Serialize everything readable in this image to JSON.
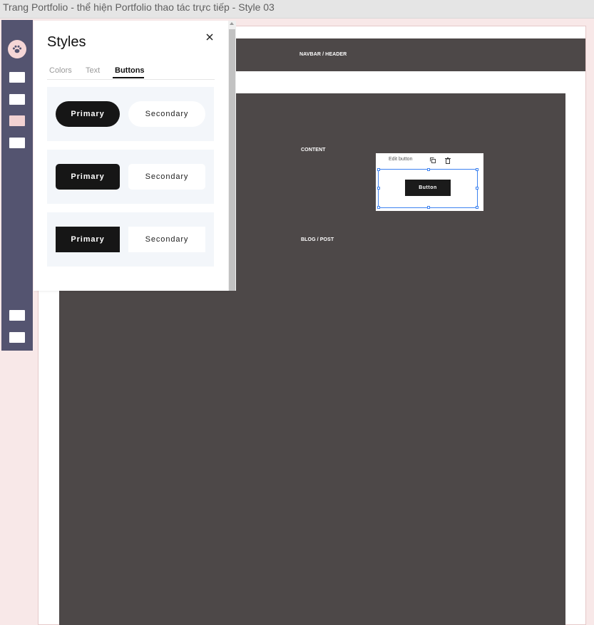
{
  "window": {
    "title": "Trang Portfolio - thể hiện Portfolio thao tác trực tiếp - Style 03"
  },
  "rail": {
    "logo_icon": "paw-icon",
    "items": [
      {
        "name": "rail-item-1",
        "active": false
      },
      {
        "name": "rail-item-2",
        "active": false
      },
      {
        "name": "rail-item-3",
        "active": true
      },
      {
        "name": "rail-item-4",
        "active": false
      },
      {
        "name": "rail-item-5",
        "active": false
      },
      {
        "name": "rail-item-6",
        "active": false
      }
    ]
  },
  "canvas": {
    "navbar_label": "NAVBAR / HEADER",
    "content_label": "CONTENT",
    "blog_label": "BLOG / POST",
    "widget": {
      "toolbar_label": "Edit button",
      "duplicate_icon": "duplicate-icon",
      "delete_icon": "trash-icon",
      "button_label": "Button"
    }
  },
  "panel": {
    "title": "Styles",
    "close_icon": "close-icon",
    "tabs": [
      {
        "label": "Colors",
        "active": false
      },
      {
        "label": "Text",
        "active": false
      },
      {
        "label": "Buttons",
        "active": true
      }
    ],
    "button_styles": [
      {
        "shape": "pill",
        "primary": "Primary",
        "secondary": "Secondary"
      },
      {
        "shape": "rounded",
        "primary": "Primary",
        "secondary": "Secondary"
      },
      {
        "shape": "square",
        "primary": "Primary",
        "secondary": "Secondary"
      }
    ]
  },
  "colors": {
    "rail": "#545470",
    "accent_pink": "#f2d2d2",
    "block_dark": "#4d4848",
    "selection_blue": "#3d82f0"
  }
}
